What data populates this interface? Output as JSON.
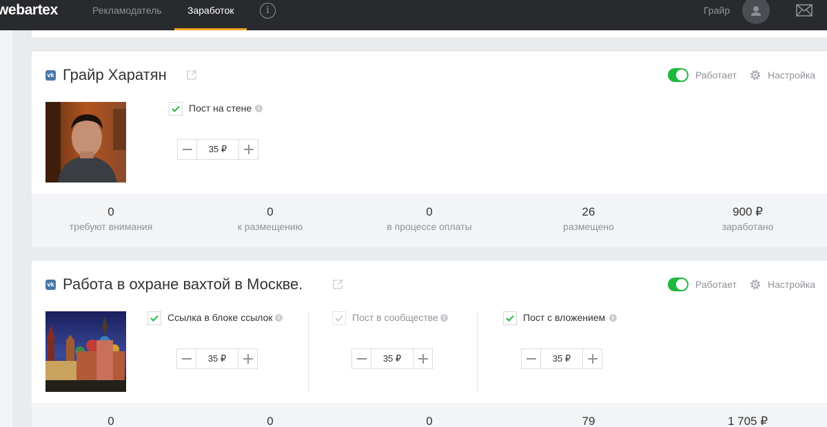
{
  "header": {
    "logo": "webartex",
    "nav": [
      {
        "label": "Рекламодатель",
        "active": false
      },
      {
        "label": "Заработок",
        "active": true
      }
    ],
    "info_icon": "info-icon",
    "user_name": "Грайр",
    "colors": {
      "background": "#282a2d",
      "active_underline": "#f5a623"
    }
  },
  "cards": [
    {
      "title": "Грайр Харатян",
      "network": "vk",
      "status_label": "Работает",
      "status_on": true,
      "settings_label": "Настройка",
      "options": [
        {
          "label": "Пост на стене",
          "checked": true,
          "disabled": false,
          "price": "35 ₽"
        }
      ],
      "stats": [
        {
          "value": "0",
          "label": "требуют внимания"
        },
        {
          "value": "0",
          "label": "к размещению"
        },
        {
          "value": "0",
          "label": "в процессе оплаты"
        },
        {
          "value": "26",
          "label": "размещено"
        },
        {
          "value": "900 ₽",
          "label": "заработано"
        }
      ]
    },
    {
      "title": "Работа в охране вахтой в Москве.",
      "network": "vk",
      "status_label": "Работает",
      "status_on": true,
      "settings_label": "Настройка",
      "options": [
        {
          "label": "Ссылка в блоке ссылок",
          "checked": true,
          "disabled": false,
          "price": "35 ₽"
        },
        {
          "label": "Пост в сообществе",
          "checked": true,
          "disabled": true,
          "price": "35 ₽"
        },
        {
          "label": "Пост с вложением",
          "checked": true,
          "disabled": false,
          "price": "35 ₽"
        }
      ],
      "stats": [
        {
          "value": "0"
        },
        {
          "value": "0"
        },
        {
          "value": "0"
        },
        {
          "value": "79"
        },
        {
          "value": "1 705 ₽"
        }
      ]
    }
  ],
  "colors": {
    "toggle_on": "#1eb83e",
    "check": "#1eb83e",
    "vk": "#4a76a8",
    "muted_text": "#8e9297"
  }
}
